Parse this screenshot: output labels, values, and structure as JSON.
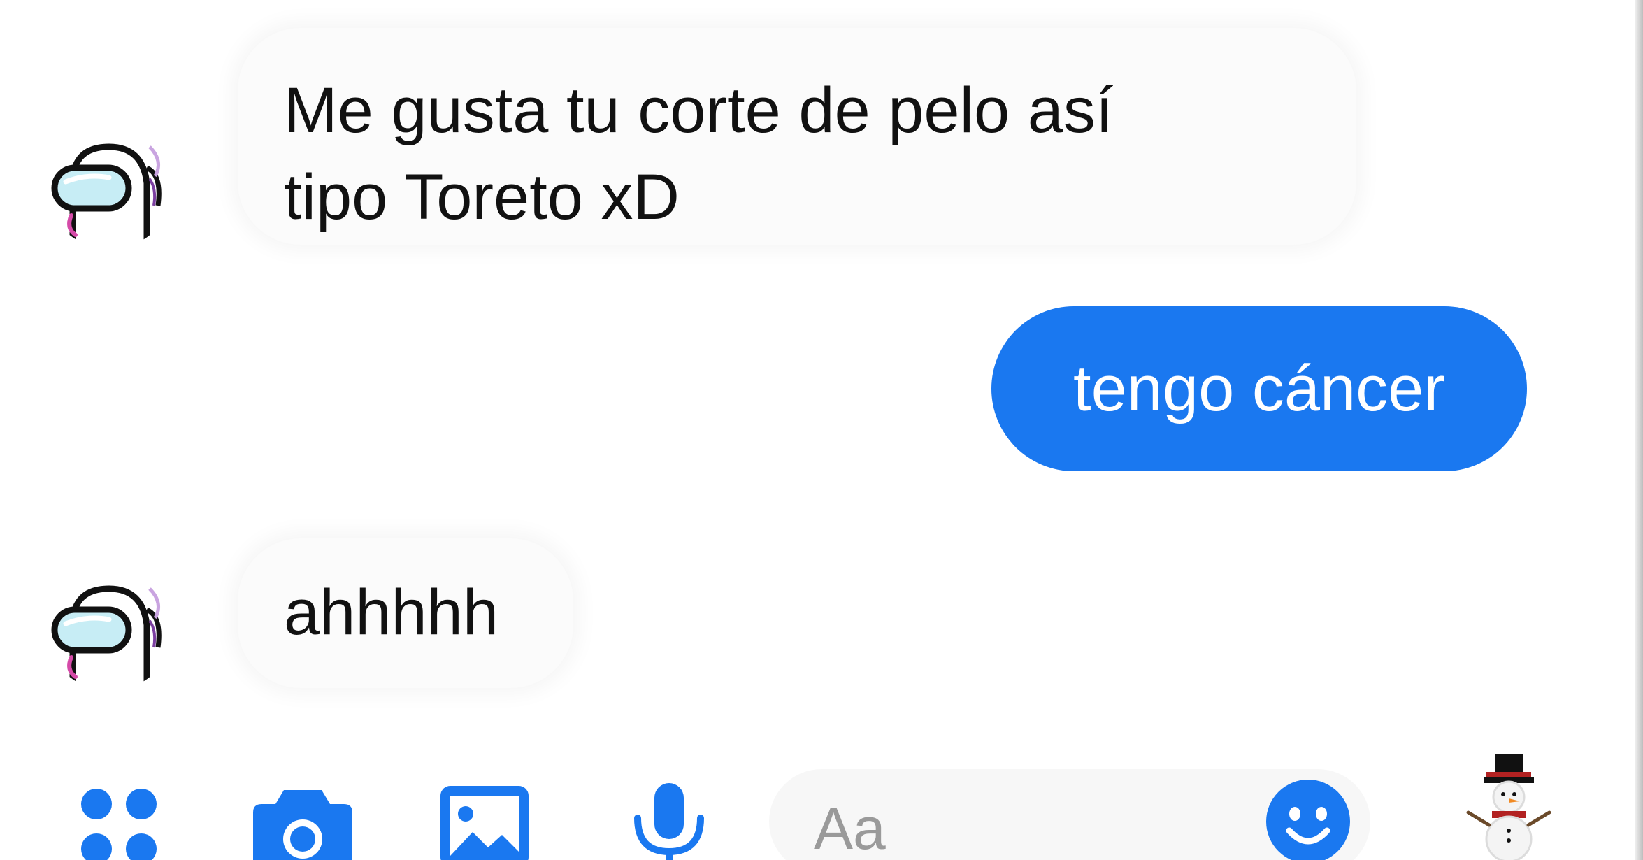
{
  "messages": [
    {
      "direction": "incoming",
      "avatar_icon": "crewmate-avatar-icon",
      "lines": [
        "Me gusta tu corte de pelo así",
        "tipo Toreto xD"
      ]
    },
    {
      "direction": "outgoing",
      "text": "tengo cáncer"
    },
    {
      "direction": "incoming",
      "avatar_icon": "crewmate-avatar-icon",
      "text": "ahhhhh"
    }
  ],
  "composer": {
    "placeholder": "Aa",
    "icons": [
      "apps-menu-icon",
      "camera-icon",
      "gallery-icon",
      "microphone-icon",
      "emoji-icon",
      "snowman-sticker-icon"
    ]
  },
  "colors": {
    "accent": "#1a78f0",
    "outgoing_text": "#ffffff",
    "incoming_bubble": "#fbfbfb",
    "incoming_text": "#111111",
    "placeholder": "#9a9a9a"
  }
}
